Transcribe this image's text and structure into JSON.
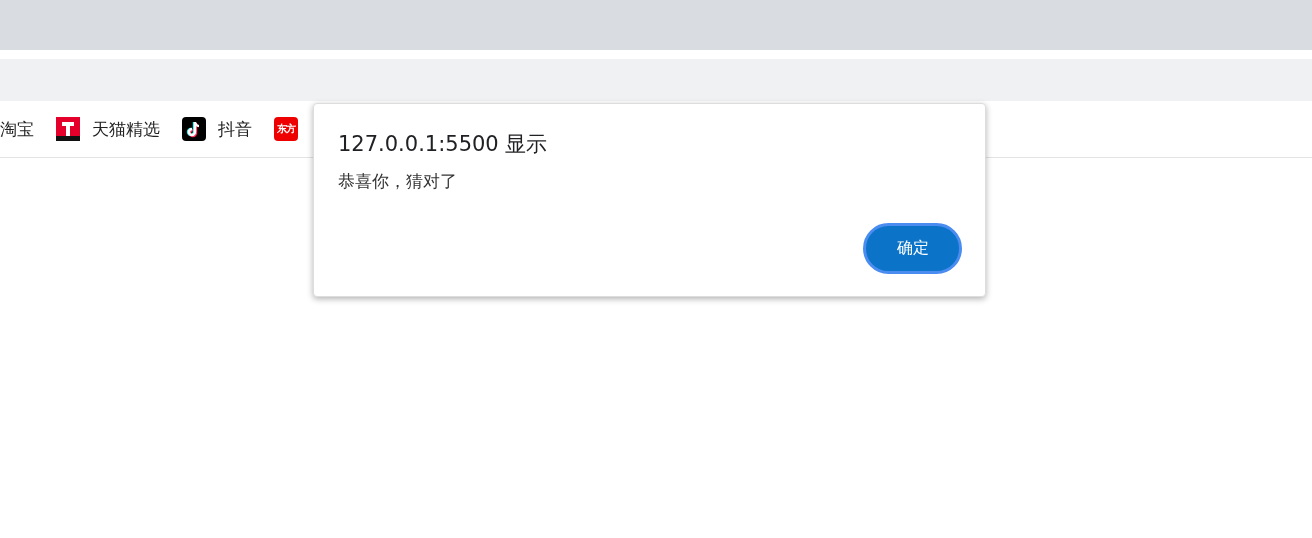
{
  "bookmarks": [
    {
      "kind": "plain",
      "label": "淘宝"
    },
    {
      "kind": "tmall",
      "label": "天猫精选"
    },
    {
      "kind": "tiktok",
      "label": "抖音"
    },
    {
      "kind": "badge",
      "badge_text": "东方"
    }
  ],
  "dialog": {
    "title": "127.0.0.1:5500 显示",
    "message": "恭喜你，猜对了",
    "button": "确定"
  }
}
